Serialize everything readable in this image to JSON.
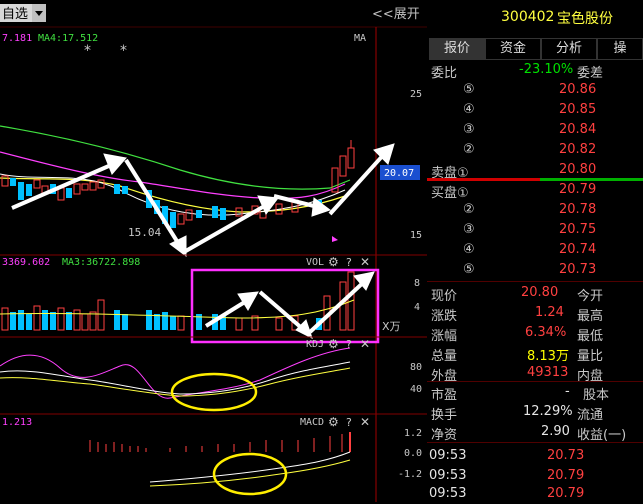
{
  "toolbar": {
    "dropdown_value": "自选",
    "expand_label": "<<展开"
  },
  "ma_labels": {
    "ma_left": "7.181",
    "ma4": "MA4:17.512",
    "ma_tag": "MA"
  },
  "price_axis": {
    "p25": "25",
    "p20": "20.07",
    "p15": "15",
    "low_label": "15.04"
  },
  "vol_labels": {
    "left": "3369.602",
    "ma3": "MA3:36722.898",
    "tag": "VOL",
    "unit": "X万",
    "t8": "8",
    "t4": "4"
  },
  "kdj_labels": {
    "tag": "KDJ",
    "t80": "80",
    "t40": "40"
  },
  "macd_labels": {
    "left": "1.213",
    "tag": "MACD",
    "t12": "1.2",
    "t00": "0.0",
    "tm12": "-1.2"
  },
  "stock": {
    "code": "300402",
    "name": "宝色股份"
  },
  "tabs": [
    "报价",
    "资金",
    "分析",
    "操"
  ],
  "weibi": {
    "label": "委比",
    "value": "-23.10%",
    "label2": "委差"
  },
  "sell_label": "卖盘①",
  "buy_label": "买盘①",
  "sells": [
    {
      "idx": "⑤",
      "price": "20.86"
    },
    {
      "idx": "④",
      "price": "20.85"
    },
    {
      "idx": "③",
      "price": "20.84"
    },
    {
      "idx": "②",
      "price": "20.82"
    },
    {
      "idx": "",
      "price": "20.80"
    }
  ],
  "buys": [
    {
      "idx": "",
      "price": "20.79"
    },
    {
      "idx": "②",
      "price": "20.78"
    },
    {
      "idx": "③",
      "price": "20.75"
    },
    {
      "idx": "④",
      "price": "20.74"
    },
    {
      "idx": "⑤",
      "price": "20.73"
    }
  ],
  "stats": [
    {
      "l": "现价",
      "v": "20.80",
      "r": "今开",
      "vc": "red"
    },
    {
      "l": "涨跌",
      "v": "1.24",
      "r": "最高",
      "vc": "red"
    },
    {
      "l": "涨幅",
      "v": "6.34%",
      "r": "最低",
      "vc": "red"
    },
    {
      "l": "总量",
      "v": "8.13万",
      "r": "量比",
      "vc": "yel"
    },
    {
      "l": "外盘",
      "v": "49313",
      "r": "内盘",
      "vc": "red"
    }
  ],
  "fundamentals": [
    {
      "l": "市盈",
      "v": "-",
      "r": "股本"
    },
    {
      "l": "换手",
      "v": "12.29%",
      "r": "流通"
    },
    {
      "l": "净资",
      "v": "2.90",
      "r": "收益(一)"
    }
  ],
  "ticks": [
    {
      "time": "09:53",
      "price": "20.73"
    },
    {
      "time": "09:53",
      "price": "20.79"
    },
    {
      "time": "09:53",
      "price": "20.79"
    }
  ],
  "colors": {
    "up": "#ff4040",
    "down": "#00c0ff",
    "ma_yellow": "#ffff40",
    "ma_green": "#40e040",
    "ma_magenta": "#ff40ff",
    "highlight": "#ff30ff",
    "circle": "#ffee00",
    "price_box": "#1a4fd0"
  }
}
